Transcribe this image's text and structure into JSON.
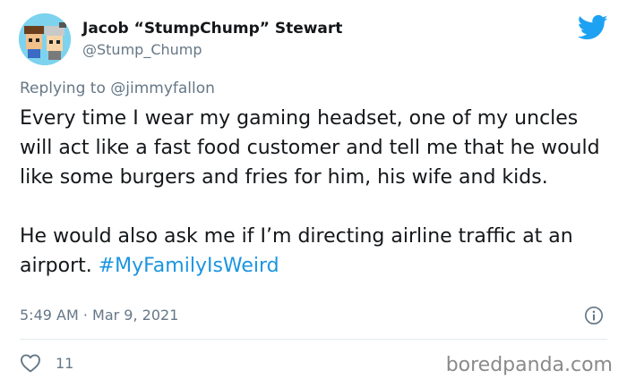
{
  "author": {
    "display_name": "Jacob “StumpChump” Stewart",
    "handle": "@Stump_Chump",
    "avatar_icon": "cartoon-characters-avatar"
  },
  "reply": {
    "prefix": "Replying to",
    "mention": "@jimmyfallon"
  },
  "tweet": {
    "paragraph1": "Every time I wear my gaming headset, one of my uncles will act like a fast food customer and tell me that he would like some burgers and fries for him, his wife and kids.",
    "paragraph2_text": "He would also ask me if I’m directing airline traffic at an airport. ",
    "hashtag": "#MyFamilyIsWeird"
  },
  "meta": {
    "timestamp": "5:49 AM · Mar 9, 2021",
    "like_count": "11"
  },
  "watermark": "boredpanda.com",
  "colors": {
    "twitter_blue": "#1da1f2",
    "hashtag_blue": "#1b95e0",
    "secondary_text": "#657786",
    "avatar_bg": "#7dd3ee"
  },
  "icons": {
    "brand": "twitter-bird-icon",
    "info": "info-icon",
    "like": "heart-icon"
  }
}
